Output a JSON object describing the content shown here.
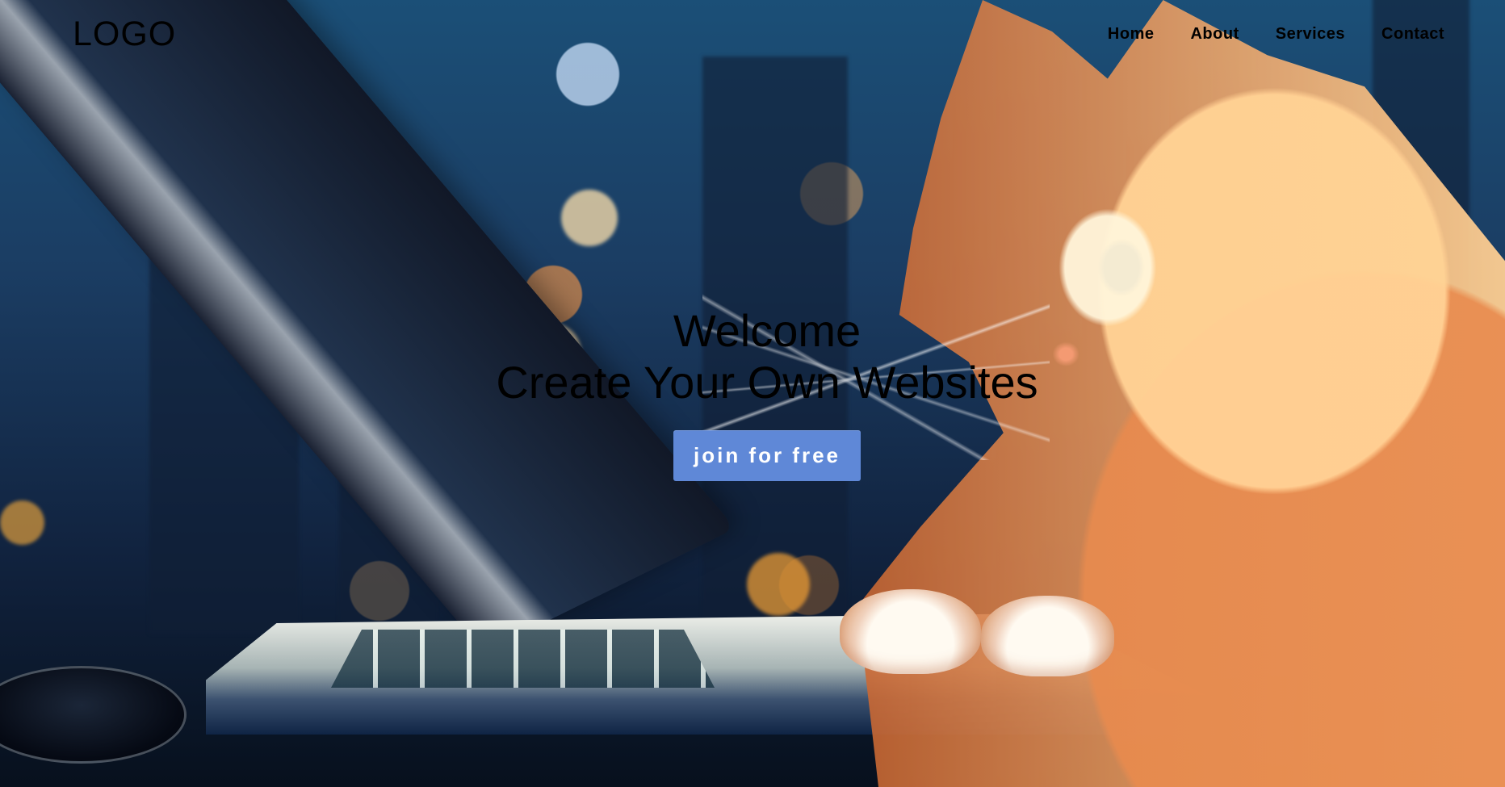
{
  "header": {
    "logo": "LOGO",
    "nav": [
      {
        "label": "Home"
      },
      {
        "label": "About"
      },
      {
        "label": "Services"
      },
      {
        "label": "Contact"
      }
    ]
  },
  "hero": {
    "welcome": "Welcome",
    "subtitle": "Create Your Own Websites",
    "cta_label": "join for free"
  },
  "colors": {
    "cta_background": "#5f88d7",
    "text": "#000000",
    "cta_text": "#ffffff"
  }
}
